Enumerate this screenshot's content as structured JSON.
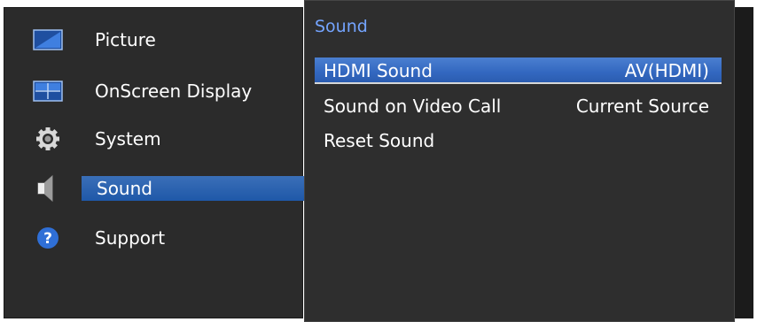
{
  "left_menu": {
    "items": [
      {
        "label": "Picture",
        "icon": "picture-icon"
      },
      {
        "label": "OnScreen Display",
        "icon": "onscreen-display-icon"
      },
      {
        "label": "System",
        "icon": "gear-icon"
      },
      {
        "label": "Sound",
        "icon": "speaker-icon",
        "selected": true
      },
      {
        "label": "Support",
        "icon": "help-icon"
      }
    ]
  },
  "submenu": {
    "title": "Sound",
    "rows": [
      {
        "name": "HDMI Sound",
        "value": "AV(HDMI)",
        "selected": true
      },
      {
        "name": "Sound on Video Call",
        "value": "Current Source"
      },
      {
        "name": "Reset Sound",
        "value": ""
      }
    ]
  },
  "colors": {
    "highlight": "#2f63b6",
    "title_blue": "#74a4ff",
    "panel_bg": "#2b2b2b"
  }
}
